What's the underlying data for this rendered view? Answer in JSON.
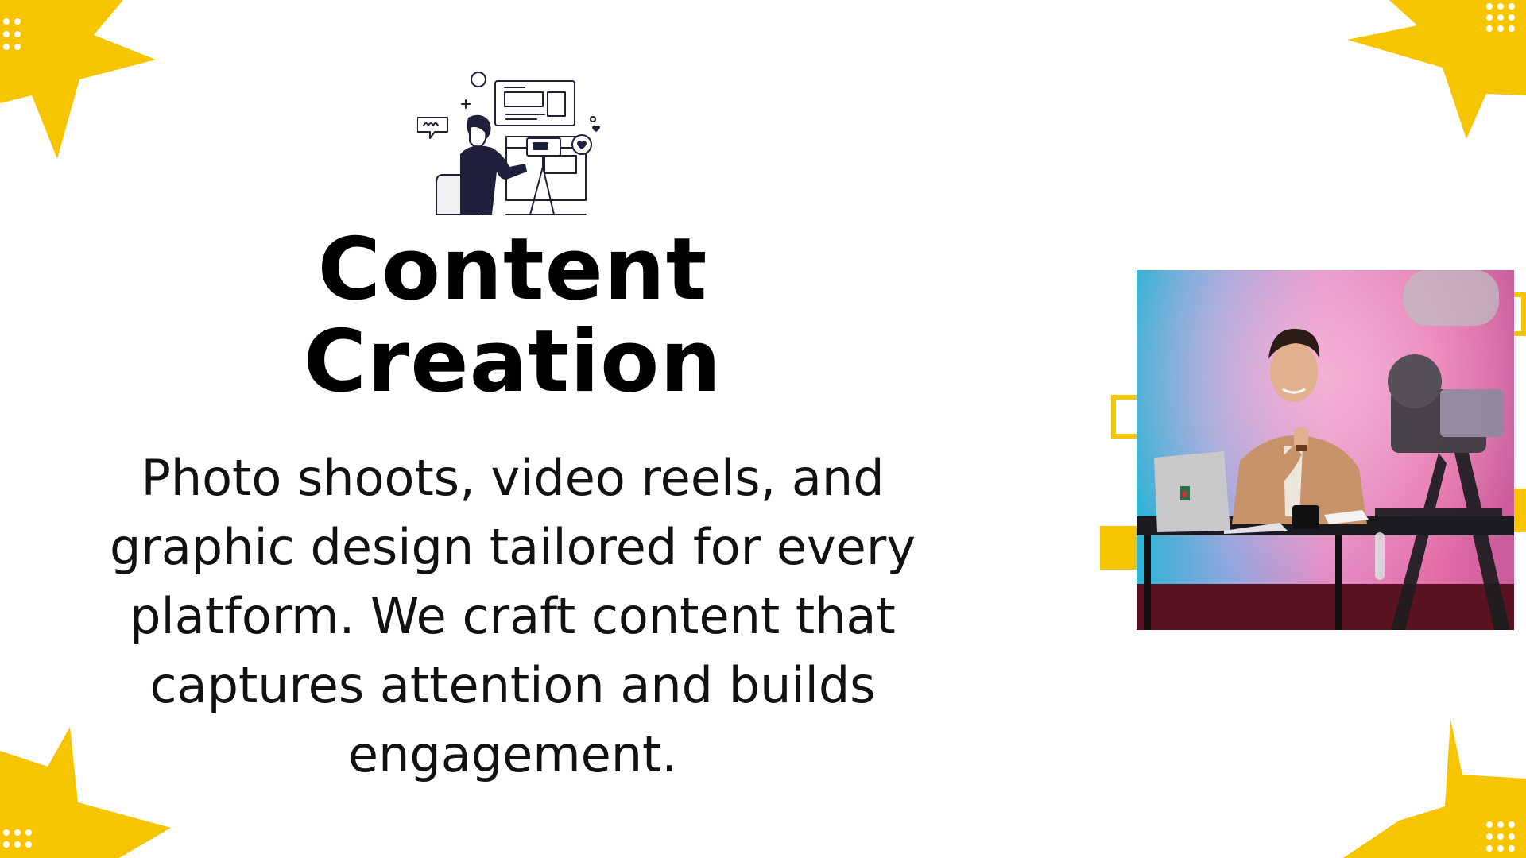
{
  "slide": {
    "title_line1": "Content",
    "title_line2": "Creation",
    "description": "Photo shoots, video reels, and graphic design tailored for every platform. We craft content that captures attention and builds engagement."
  },
  "colors": {
    "accent_yellow": "#F7C500",
    "text": "#000000",
    "background": "#FFFFFF"
  },
  "icons": {
    "illustration": "content-creator-illustration",
    "corner_shape": "star-burst",
    "photo": "creator-at-desk-photo"
  }
}
